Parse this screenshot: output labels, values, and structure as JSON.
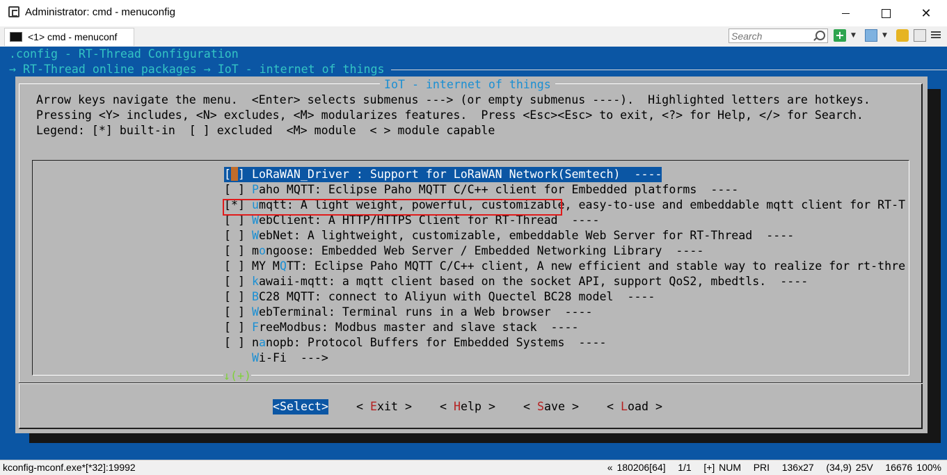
{
  "window": {
    "title": "Administrator: cmd - menuconfig",
    "tab_label": "<1> cmd - menuconf",
    "search_placeholder": "Search"
  },
  "console": {
    "config_line": ".config - RT-Thread Configuration",
    "breadcrumb": "→ RT-Thread online packages → IoT - internet of things"
  },
  "dialog": {
    "title": "IoT - internet of things",
    "help_lines": [
      "Arrow keys navigate the menu.  <Enter> selects submenus ---> (or empty submenus ----).  Highlighted letters are hotkeys.",
      "Pressing <Y> includes, <N> excludes, <M> modularizes features.  Press <Esc><Esc> to exit, <?> for Help, </> for Search.",
      "Legend: [*] built-in  [ ] excluded  <M> module  < > module capable"
    ],
    "items": [
      {
        "pre": "[ ] ",
        "hotkey": "L",
        "rest": "oRaWAN_Driver : Support for LoRaWAN Network(Semtech)  ----",
        "selected": true
      },
      {
        "pre": "[ ] ",
        "hotkey": "P",
        "rest": "aho MQTT: Eclipse Paho MQTT C/C++ client for Embedded platforms  ----",
        "selected": false
      },
      {
        "pre": "[*] ",
        "hotkey": "u",
        "rest": "mqtt: A light weight, powerful, customizable, easy-to-use and embeddable mqtt client for RT-T",
        "selected": false
      },
      {
        "pre": "[ ] ",
        "hotkey": "W",
        "rest": "ebClient: A HTTP/HTTPS Client for RT-Thread  ----",
        "selected": false
      },
      {
        "pre": "[ ] ",
        "hotkey": "W",
        "rest": "ebNet: A lightweight, customizable, embeddable Web Server for RT-Thread  ----",
        "selected": false
      },
      {
        "pre": "[ ] m",
        "hotkey": "o",
        "rest": "ngoose: Embedded Web Server / Embedded Networking Library  ----",
        "selected": false
      },
      {
        "pre": "[ ] MY M",
        "hotkey": "Q",
        "rest": "TT: Eclipse Paho MQTT C/C++ client, A new efficient and stable way to realize for rt-thre",
        "selected": false
      },
      {
        "pre": "[ ] ",
        "hotkey": "k",
        "rest": "awaii-mqtt: a mqtt client based on the socket API, support QoS2, mbedtls.  ----",
        "selected": false
      },
      {
        "pre": "[ ] ",
        "hotkey": "B",
        "rest": "C28 MQTT: connect to Aliyun with Quectel BC28 model  ----",
        "selected": false
      },
      {
        "pre": "[ ] ",
        "hotkey": "W",
        "rest": "ebTerminal: Terminal runs in a Web browser  ----",
        "selected": false
      },
      {
        "pre": "[ ] ",
        "hotkey": "F",
        "rest": "reeModbus: Modbus master and slave stack  ----",
        "selected": false
      },
      {
        "pre": "[ ] n",
        "hotkey": "a",
        "rest": "nopb: Protocol Buffers for Embedded Systems  ----",
        "selected": false
      },
      {
        "pre": "    ",
        "hotkey": "W",
        "rest": "i-Fi  --->",
        "selected": false
      }
    ],
    "more_indicator": "↓(+)",
    "buttons": [
      {
        "pre": "<",
        "hotkey": "",
        "label": "Select",
        "post": ">",
        "selected": true
      },
      {
        "pre": "< ",
        "hotkey": "E",
        "label": "xit",
        "post": " >",
        "selected": false
      },
      {
        "pre": "< ",
        "hotkey": "H",
        "label": "elp",
        "post": " >",
        "selected": false
      },
      {
        "pre": "< ",
        "hotkey": "S",
        "label": "ave",
        "post": " >",
        "selected": false
      },
      {
        "pre": "< ",
        "hotkey": "L",
        "label": "oad",
        "post": " >",
        "selected": false
      }
    ]
  },
  "statusbar": {
    "process": "kconfig-mconf.exe*[*32]:19992",
    "info": "« 180206[64]   1/1   [+] NUM   PRI   136x27   (34,9) 25V   16676 100%"
  },
  "colors": {
    "console_bg": "#0b56a4",
    "dialog_bg": "#b8b8b8",
    "hotkey_menu": "#1b8fd3",
    "hotkey_button": "#b51f1f",
    "annotation": "#e01b1b"
  }
}
